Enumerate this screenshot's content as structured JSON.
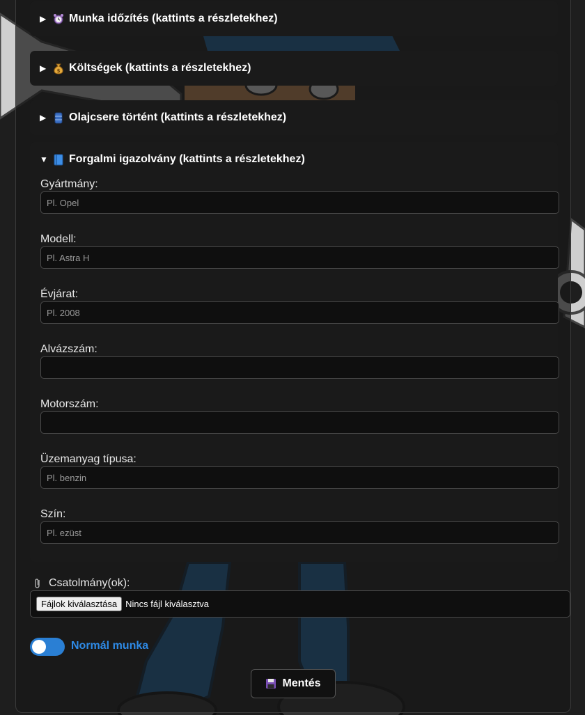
{
  "sections": [
    {
      "arrow": "▶",
      "icon": "alarm-clock-icon",
      "title": "Munka időzítés (kattints a részletekhez)",
      "expanded": false
    },
    {
      "arrow": "▶",
      "icon": "money-bag-icon",
      "title": "Költségek (kattints a részletekhez)",
      "expanded": false
    },
    {
      "arrow": "▶",
      "icon": "oil-drum-icon",
      "title": "Olajcsere történt (kattints a részletekhez)",
      "expanded": false
    },
    {
      "arrow": "▼",
      "icon": "blue-book-icon",
      "title": "Forgalmi igazolvány (kattints a részletekhez)",
      "expanded": true
    }
  ],
  "fields": [
    {
      "label": "Gyártmány:",
      "placeholder": "Pl. Opel",
      "value": ""
    },
    {
      "label": "Modell:",
      "placeholder": "Pl. Astra H",
      "value": ""
    },
    {
      "label": "Évjárat:",
      "placeholder": "Pl. 2008",
      "value": ""
    },
    {
      "label": "Alvázszám:",
      "placeholder": "",
      "value": ""
    },
    {
      "label": "Motorszám:",
      "placeholder": "",
      "value": ""
    },
    {
      "label": "Üzemanyag típusa:",
      "placeholder": "Pl. benzin",
      "value": ""
    },
    {
      "label": "Szín:",
      "placeholder": "Pl. ezüst",
      "value": ""
    }
  ],
  "attachments": {
    "icon": "paperclip-icon",
    "label": "Csatolmány(ok):",
    "button_label": "Fájlok kiválasztása",
    "status": "Nincs fájl kiválasztva"
  },
  "toggle": {
    "label": "Normál munka",
    "on": true,
    "color": "#2e8ae6"
  },
  "save": {
    "icon": "floppy-disk-icon",
    "label": "Mentés"
  }
}
